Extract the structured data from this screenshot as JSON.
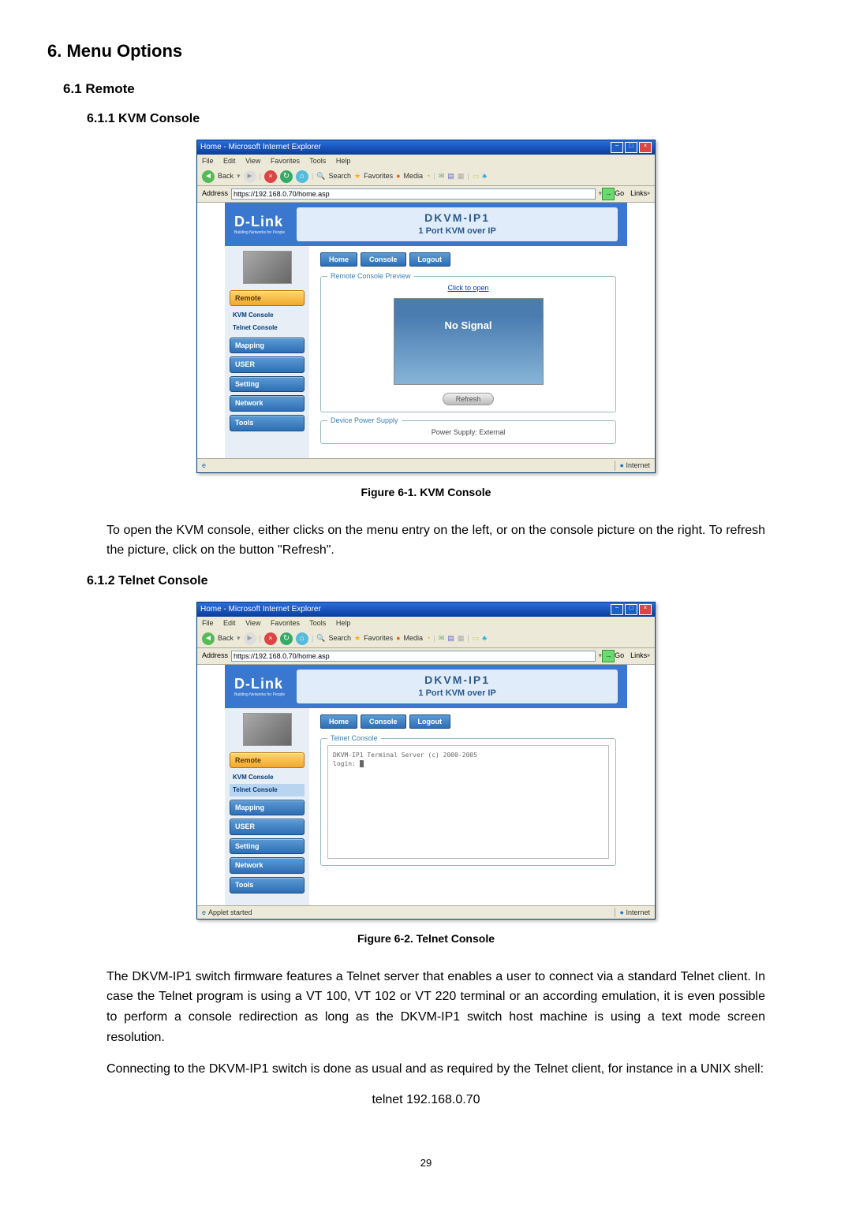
{
  "section": {
    "h1": "6.  Menu Options",
    "h2_1": "6.1 Remote",
    "h3_1": "6.1.1    KVM Console",
    "fig1_caption": "Figure 6-1. KVM Console",
    "para1": "To open the KVM console, either clicks on the menu entry on the left, or on the console picture on the right. To refresh the picture, click on the button \"Refresh\".",
    "h3_2": "6.1.2    Telnet Console",
    "fig2_caption": "Figure 6-2. Telnet Console",
    "para2": "The DKVM-IP1 switch firmware features a Telnet server that enables a user to connect via a standard Telnet client. In case the Telnet program is using a VT 100, VT 102 or VT 220 terminal or an according emulation, it is even possible to perform a console redirection as long as the DKVM-IP1 switch host machine is using a text mode screen resolution.",
    "para3": "Connecting to the DKVM-IP1 switch is done as usual and as required by the Telnet client, for instance in a UNIX shell:",
    "cmd": "telnet 192.168.0.70",
    "page_number": "29"
  },
  "ie": {
    "title1": "Home - Microsoft Internet Explorer",
    "title2": "Home - Microsoft Internet Explorer",
    "menus": {
      "file": "File",
      "edit": "Edit",
      "view": "View",
      "favorites": "Favorites",
      "tools": "Tools",
      "help": "Help"
    },
    "toolbar": {
      "back": "Back",
      "search": "Search",
      "favorites": "Favorites",
      "media": "Media"
    },
    "address_label": "Address",
    "address_url": "https://192.168.0.70/home.asp",
    "go": "Go",
    "links": "Links",
    "status_applet": "Applet started",
    "status_done": "",
    "status_zone": "Internet"
  },
  "dlink": {
    "logo": "D-Link",
    "sublogo": "Building Networks for People",
    "product": "DKVM-IP1",
    "subtitle": "1 Port KVM over IP",
    "tabs": {
      "home": "Home",
      "console": "Console",
      "logout": "Logout"
    },
    "sidebar": {
      "remote": "Remote",
      "kvm_console": "KVM Console",
      "telnet_console": "Telnet Console",
      "mapping": "Mapping",
      "user": "USER",
      "setting": "Setting",
      "network": "Network",
      "tools": "Tools"
    },
    "fig1": {
      "legend1": "Remote Console Preview",
      "click_open": "Click to open",
      "no_signal": "No Signal",
      "refresh": "Refresh",
      "legend2": "Device Power Supply",
      "power": "Power Supply: External"
    },
    "fig2": {
      "legend": "Telnet Console",
      "terminal_line": "DKVM-IP1 Terminal Server (c) 2000-2005",
      "login_prompt": "login:"
    }
  }
}
